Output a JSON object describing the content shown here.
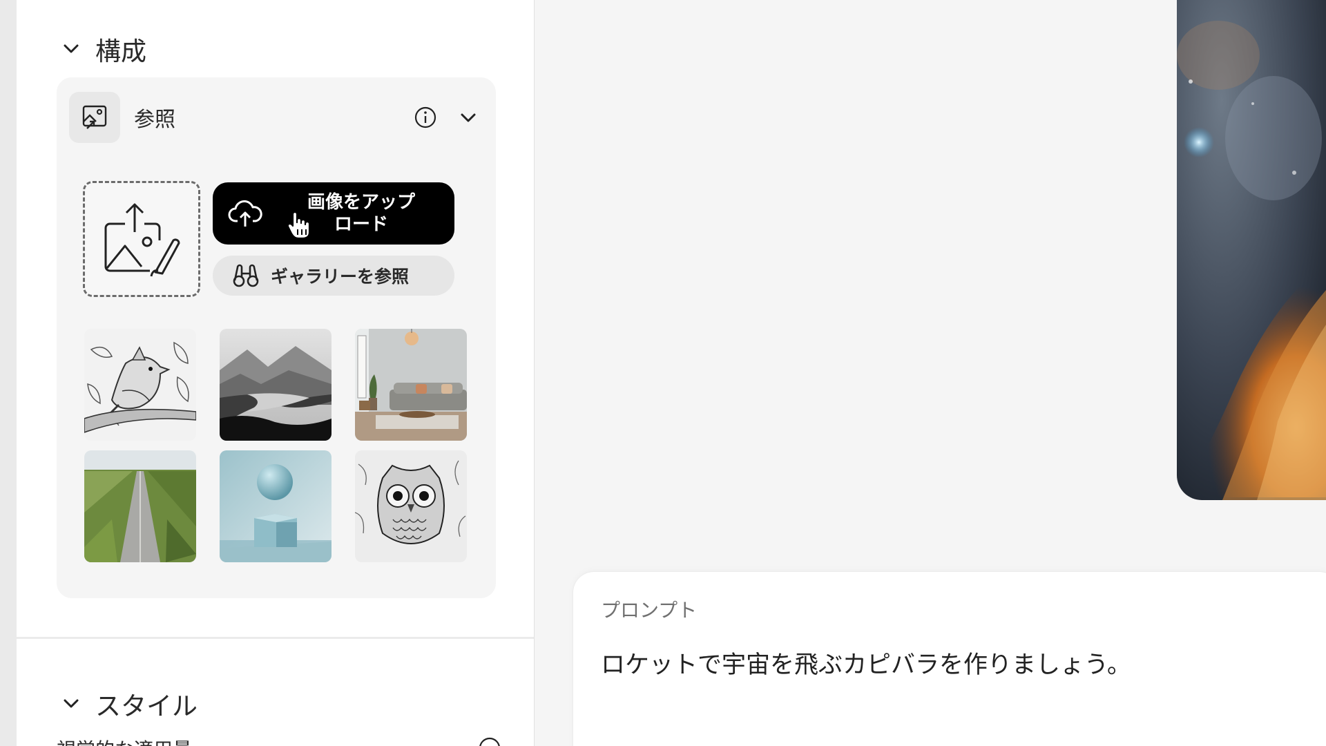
{
  "composition": {
    "title": "構成"
  },
  "reference": {
    "label": "参照",
    "upload_label_line1": "画像をアップ",
    "upload_label_line2": "ロード",
    "gallery_label": "ギャラリーを参照",
    "thumbnails": [
      "bird-sketch",
      "misty-mountain-lake",
      "living-room",
      "country-road",
      "sphere-on-cube",
      "owl-sketch"
    ]
  },
  "style": {
    "title": "スタイル",
    "sub_label": "視覚的な適用量"
  },
  "prompt": {
    "label": "プロンプト",
    "text": "ロケットで宇宙を飛ぶカピバラを作りましょう。"
  },
  "icons": [
    "chevron-down-icon",
    "reference-image-icon",
    "info-icon",
    "upload-image-icon",
    "cloud-upload-icon",
    "hand-cursor-icon",
    "binoculars-icon"
  ],
  "colors": {
    "primary_button": "#000000",
    "secondary_button": "#e6e6e6",
    "card_bg": "#f5f5f5"
  }
}
